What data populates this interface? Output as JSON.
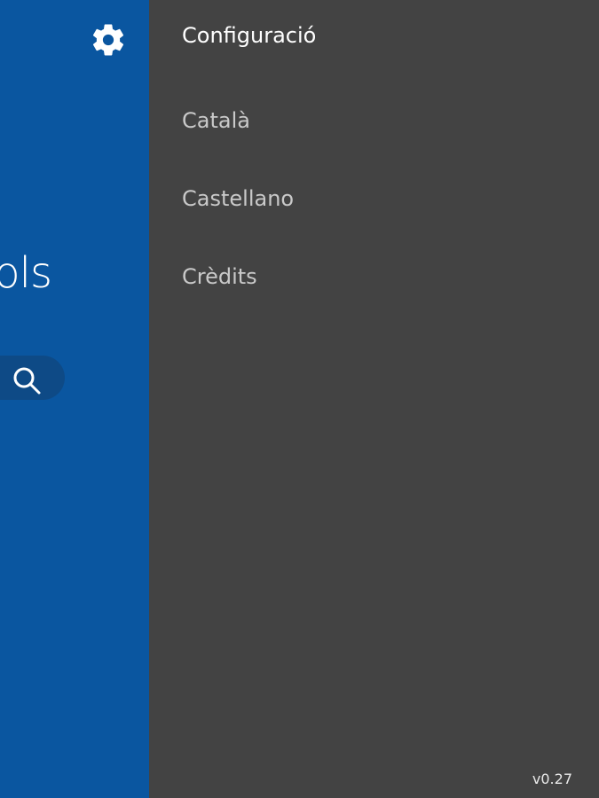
{
  "main": {
    "title": "ols",
    "settings_icon": "gear-icon",
    "search_icon": "search-icon"
  },
  "drawer": {
    "header": "Configuració",
    "items": [
      {
        "label": "Català"
      },
      {
        "label": "Castellano"
      },
      {
        "label": "Crèdits"
      }
    ],
    "version": "v0.27"
  },
  "colors": {
    "primary": "#0a56a0",
    "search_background": "#0e4a86",
    "drawer_background": "#434343",
    "drawer_header_text": "#ffffff",
    "drawer_item_text": "#c9c9c9"
  }
}
